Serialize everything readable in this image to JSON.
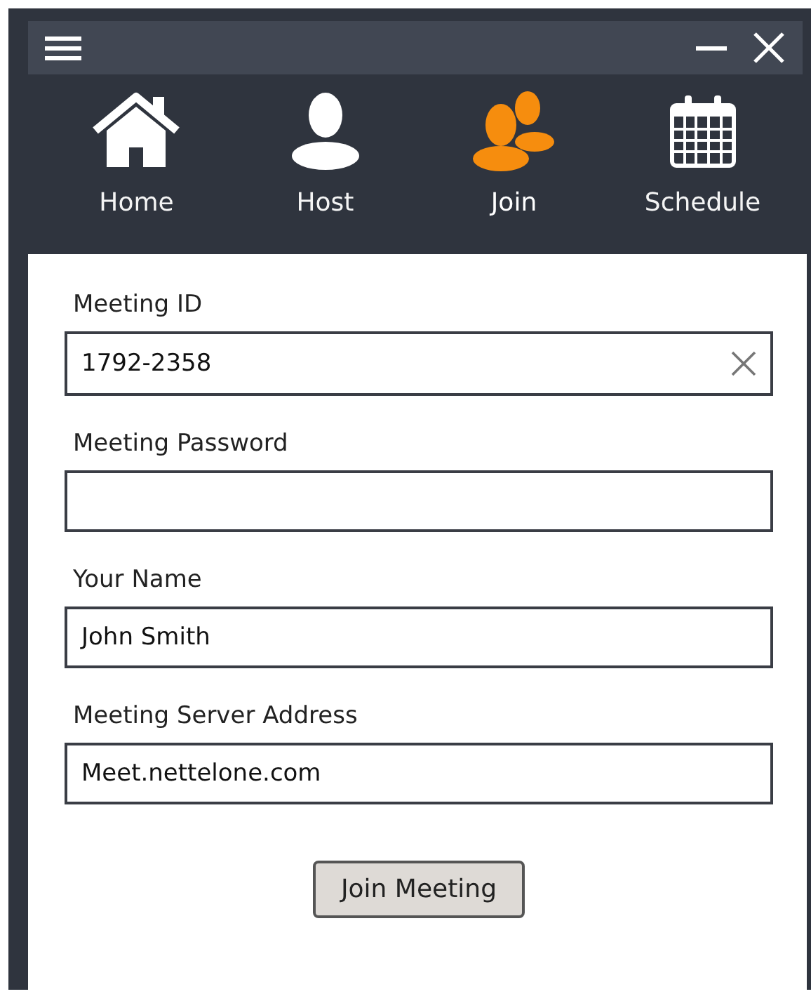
{
  "tabs": [
    {
      "label": "Home",
      "selected": false
    },
    {
      "label": "Host",
      "selected": false
    },
    {
      "label": "Join",
      "selected": true
    },
    {
      "label": "Schedule",
      "selected": false
    }
  ],
  "fields": [
    {
      "label": "Meeting ID",
      "value": "1792-2358",
      "clearable": true
    },
    {
      "label": "Meeting Password",
      "clearable": false
    },
    {
      "label": "Your Name",
      "value": "John Smith",
      "clearable": false
    },
    {
      "label": "Meeting Server Address",
      "value": "Meet.nettelone.com",
      "clearable": false
    }
  ],
  "button": "Join Meeting"
}
